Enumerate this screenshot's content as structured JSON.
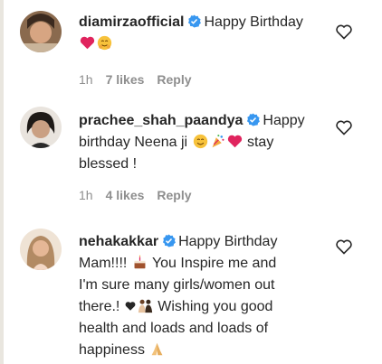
{
  "comments": [
    {
      "username": "diamirzaofficial",
      "text_1": "Happy Birthday",
      "text_2": "",
      "time": "1h",
      "likes": "7 likes",
      "reply": "Reply"
    },
    {
      "username": "prachee_shah_paandya",
      "text_1": "Happy",
      "text_2": "birthday Neena ji",
      "text_3": "stay",
      "text_4": "blessed !",
      "time": "1h",
      "likes": "4 likes",
      "reply": "Reply"
    },
    {
      "username": "nehakakkar",
      "text_1": "Happy Birthday",
      "text_2": "Mam!!!!",
      "text_3": "You Inspire me and",
      "text_4": "I'm sure many girls/women out",
      "text_5": "there.!",
      "text_6": "Wishing you good",
      "text_7": "health and loads and loads of",
      "text_8": "happiness"
    }
  ],
  "colors": {
    "verified": "#3897f0",
    "heart_red": "#e0245e",
    "meta_gray": "#8e8e8e"
  }
}
